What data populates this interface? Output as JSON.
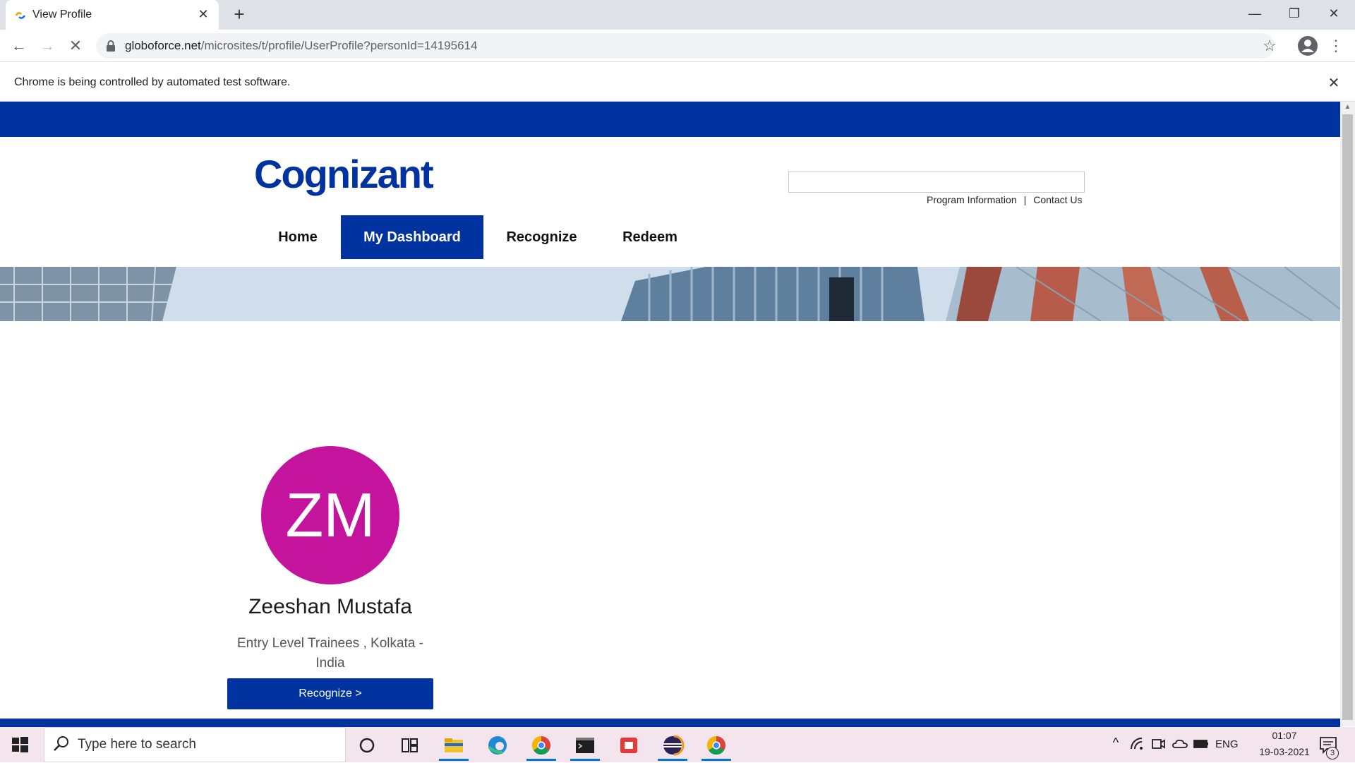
{
  "browser": {
    "tab_title": "View Profile",
    "url_host": "globoforce.net",
    "url_path": "/microsites/t/profile/UserProfile?personId=14195614",
    "infobar_text": "Chrome is being controlled by automated test software."
  },
  "site": {
    "logo_text": "Cognizant",
    "search_value": "",
    "util_links": [
      "Program Information",
      "Contact Us"
    ],
    "util_separator": "|",
    "nav": [
      "Home",
      "My Dashboard",
      "Recognize",
      "Redeem"
    ],
    "active_nav": "My Dashboard",
    "brand_color": "#0033a0"
  },
  "profile": {
    "initials": "ZM",
    "avatar_color": "#c4139d",
    "name": "Zeeshan Mustafa",
    "info": "Entry Level Trainees , Kolkata - India",
    "recognize_button": "Recognize >"
  },
  "taskbar": {
    "search_placeholder": "Type here to search",
    "language": "ENG",
    "time": "01:07",
    "date": "19-03-2021",
    "notification_count": "3"
  }
}
